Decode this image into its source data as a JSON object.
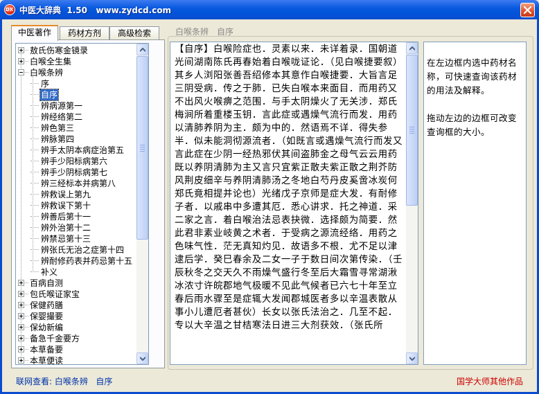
{
  "window": {
    "title": "中医大辞典  1.50   www.zydcd.com"
  },
  "tabs": [
    {
      "label": "中医著作",
      "active": true
    },
    {
      "label": "药材方剂",
      "active": false
    },
    {
      "label": "高级检索",
      "active": false
    }
  ],
  "tree": {
    "items": [
      {
        "label": "敖氏伤寒金镜录",
        "expander": "plus"
      },
      {
        "label": "白喉全生集",
        "expander": "plus"
      },
      {
        "label": "白喉条辨",
        "expander": "minus"
      },
      {
        "label": "序",
        "expander": "none"
      },
      {
        "label": "自序",
        "expander": "none",
        "selected": true
      },
      {
        "label": "辨病源第一",
        "expander": "none"
      },
      {
        "label": "辨经络第二",
        "expander": "none"
      },
      {
        "label": "辨色第三",
        "expander": "none"
      },
      {
        "label": "辨脉第四",
        "expander": "none"
      },
      {
        "label": "辨手太阴本病症治第五",
        "expander": "none"
      },
      {
        "label": "辨手少阳标病第六",
        "expander": "none"
      },
      {
        "label": "辨手少阴标病第七",
        "expander": "none"
      },
      {
        "label": "辨三经标本并病第八",
        "expander": "none"
      },
      {
        "label": "辨救误上第九",
        "expander": "none"
      },
      {
        "label": "辨救误下第十",
        "expander": "none"
      },
      {
        "label": "辨善后第十一",
        "expander": "none"
      },
      {
        "label": "辨外治第十二",
        "expander": "none"
      },
      {
        "label": "辨禁忌第十三",
        "expander": "none"
      },
      {
        "label": "辨张氏无治之症第十四",
        "expander": "none"
      },
      {
        "label": "辨耐修药表并药忌第十五",
        "expander": "none"
      },
      {
        "label": "补义",
        "expander": "none"
      },
      {
        "label": "百病自测",
        "expander": "plus"
      },
      {
        "label": "包氏喉证家宝",
        "expander": "plus"
      },
      {
        "label": "保健药膳",
        "expander": "plus"
      },
      {
        "label": "保婴撮要",
        "expander": "plus"
      },
      {
        "label": "保幼新编",
        "expander": "plus"
      },
      {
        "label": "备急千金要方",
        "expander": "plus"
      },
      {
        "label": "本草备要",
        "expander": "plus"
      },
      {
        "label": "本草便读",
        "expander": "plus"
      }
    ]
  },
  "header": {
    "book": "白喉条辨",
    "chapter": "自序"
  },
  "content": {
    "heading": "【自序】",
    "text": "白喉险症也．灵素以来．未详着录．国朝道光间湖南陈氏再春始着白喉咙证论．（见白喉捷要叙）其乡人浏阳张善吾绍修本其意作白喉捷要．大旨言足三阴受病．传之于肺．已失白喉本来面目．而用药又不出风火喉痹之范围．与手太阴燥火了无关涉．郑氏梅涧所着重楼玉钥．言此症或遇燥气流行而发．用药以清肺养阴为主．颇为中的．然语焉不详．得失参半．似未能洞彻源流者．（如既言或遇燥气流行而发又言此症在少阴一经热邪伏其间盗肺金之母气云云用药既以养阴清肺为主又言只宜紫正散夫紫正散之荆芥防风荆皮细辛与养阴清肺汤之冬地白芍丹皮奚啻冰炭何郑氏竟相提并论也）光绪戊子京师是症大发．有耐修子者．以戚串中多遭其厄．悉心讲求．托之神道．采二家之言．着白喉治法忌表抉微．选择颇为简要．然此君非素业岐黄之术者．于受病之源流经络．用药之色味气性．茫无真知灼见．故语多不根．尤不足以津逮后学．癸巳春余及二女一子于数日间次第传染．（壬辰秋冬之交天久不雨燥气盛行冬至后大霜雪寻常湖湫冰浓寸许皖郡地气极暖不见此气候者已六七十年至立春后雨水骤至是症辄大发闻郡城医者多以辛温表散从事小儿遭厄者甚伙）长女以张氏法治之．几至不起．专以大辛温之甘桔寒法日进三大剂获效．（张氏所"
  },
  "help": {
    "paragraphs": [
      "在左边框内选中药材名称，可快速查询该药材的用法及解释。",
      "拖动左边的边框可改变查询框的大小。"
    ]
  },
  "status": {
    "left_prefix": "联网查看:",
    "left_book": "白喉条辨",
    "left_chapter": "自序",
    "right": "国学大师其他作品"
  }
}
